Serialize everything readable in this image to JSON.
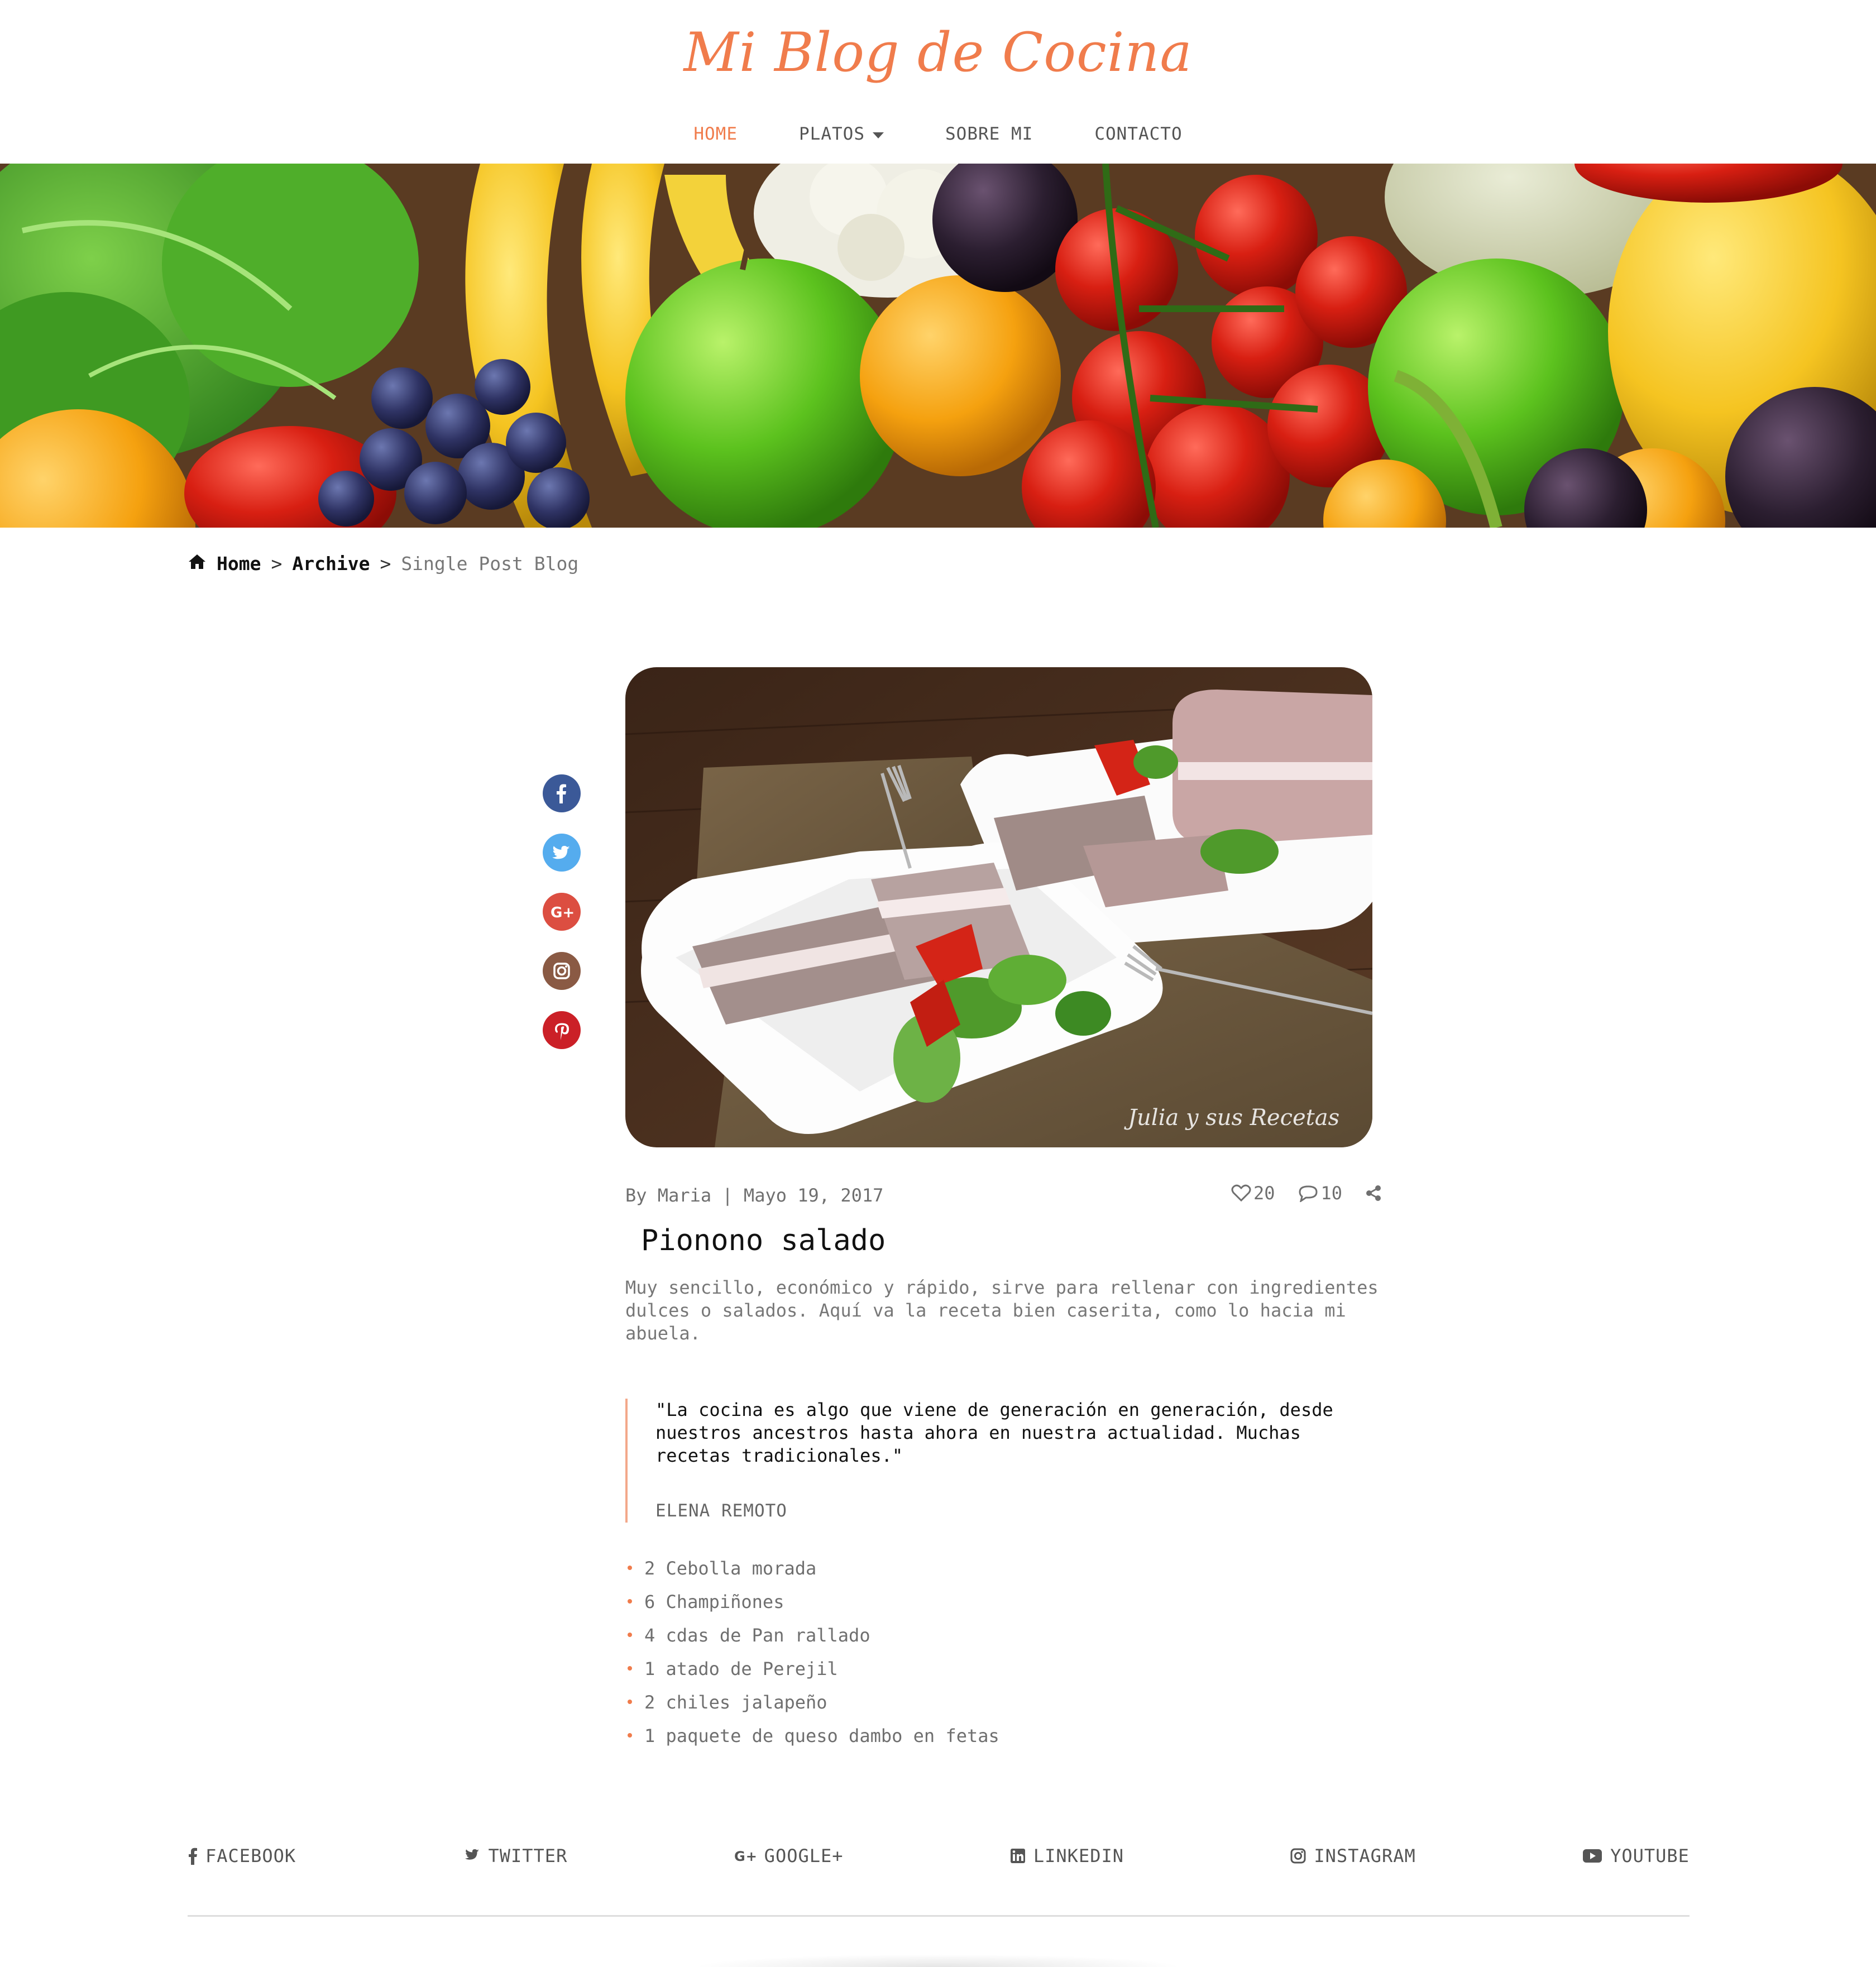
{
  "site": {
    "title": "Mi Blog de Cocina",
    "accent_color": "#f07c4c"
  },
  "nav": {
    "items": [
      {
        "label": "HOME",
        "active": true
      },
      {
        "label": "PLATOS",
        "has_dropdown": true
      },
      {
        "label": "SOBRE MI"
      },
      {
        "label": "CONTACTO"
      }
    ]
  },
  "hero": {
    "icon": "fruits-and-vegetables-banner"
  },
  "breadcrumb": {
    "home": "Home",
    "sep": ">",
    "archive": "Archive",
    "current": "Single Post Blog"
  },
  "share": [
    {
      "name": "facebook",
      "color": "#3b5998"
    },
    {
      "name": "twitter",
      "color": "#55acee"
    },
    {
      "name": "google-plus",
      "color": "#dc4e41"
    },
    {
      "name": "instagram",
      "color": "#8a5a44"
    },
    {
      "name": "pinterest",
      "color": "#cb2027"
    }
  ],
  "post": {
    "image_watermark": "Julia y sus Recetas",
    "meta": "By Maria | Mayo 19, 2017",
    "likes": "20",
    "comments": "10",
    "title": "Pionono salado",
    "excerpt": "Muy sencillo, económico y rápido, sirve para rellenar con ingredientes dulces o salados. Aquí va la receta bien caserita, como lo hacia mi abuela.",
    "quote": {
      "text": "\"La cocina es algo que viene de generación en generación, desde nuestros ancestros hasta ahora en nuestra actualidad. Muchas recetas tradicionales.\"",
      "author": "ELENA REMOTO"
    },
    "ingredients": [
      "2 Cebolla morada",
      "6 Champiñones",
      "4 cdas de Pan rallado",
      "1 atado de Perejil",
      "2 chiles jalapeño",
      "1 paquete de queso dambo en fetas"
    ]
  },
  "footer": {
    "links": {
      "facebook": "FACEBOOK",
      "twitter": "TWITTER",
      "googleplus": "GOOGLE+",
      "linkedin": "LINKEDIN",
      "instagram": "INSTAGRAM",
      "youtube": "YOUTUBE"
    }
  }
}
